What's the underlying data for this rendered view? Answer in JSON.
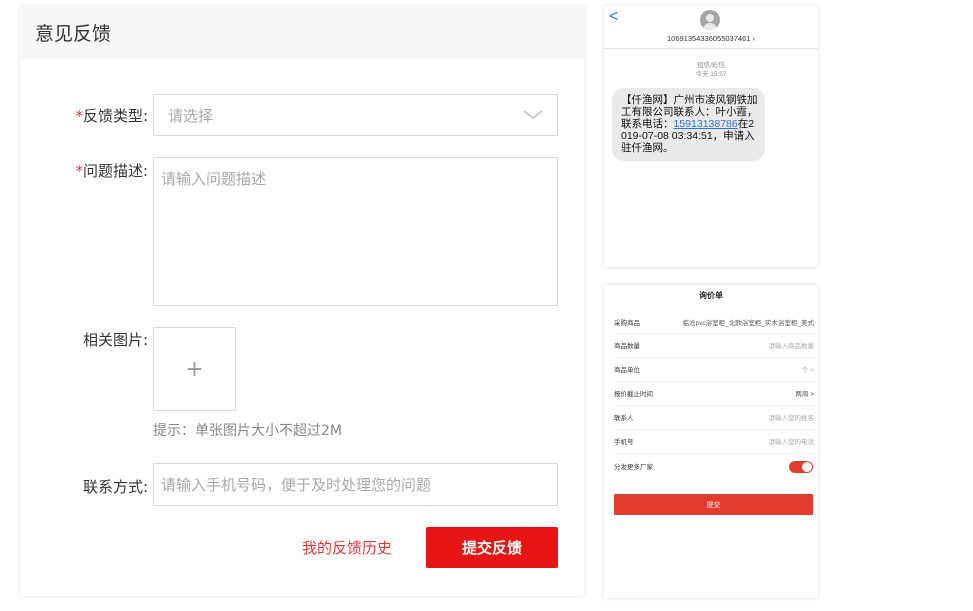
{
  "feedback": {
    "title": "意见反馈",
    "type_required": "*",
    "type_label": "反馈类型:",
    "type_placeholder": "请选择",
    "desc_required": "*",
    "desc_label": "问题描述:",
    "desc_placeholder": "请输入问题描述",
    "image_label": "相关图片:",
    "upload_symbol": "+",
    "image_hint": "提示：单张图片大小不超过2M",
    "contact_label": "联系方式:",
    "contact_placeholder": "请输入手机号码，便于及时处理您的问题",
    "history_link": "我的反馈历史",
    "submit_button": "提交反馈",
    "accent_color": "#e81414"
  },
  "sms": {
    "back_symbol": "<",
    "sender_number": "10691354336055037461 ›",
    "message_type": "短信/彩信",
    "time": "今天 15:57",
    "message_prefix": "【仟渔网】广州市凌风钢铁加工有限公司联系人：叶小霞，联系电话：",
    "phone_link": "15913138786",
    "message_suffix": "在2019-07-08 03:34:51，申请入驻仟渔网。"
  },
  "inquiry": {
    "title": "询价单",
    "rows": [
      {
        "label": "采购商品",
        "value": "临沧pvc浴室柜_北欧浴室柜_实木浴室柜_美式"
      },
      {
        "label": "商品数量",
        "value": "请输入商品数量"
      },
      {
        "label": "商品单位",
        "value": "个  >"
      },
      {
        "label": "报价截止时间",
        "value": "两周  >"
      },
      {
        "label": "联系人",
        "value": "请输入您的姓名"
      },
      {
        "label": "手机号",
        "value": "请输入您的电话"
      },
      {
        "label": "分发更多厂家",
        "value": ""
      }
    ],
    "distribute_enabled": true,
    "submit_button": "提交",
    "accent_color": "#e33b2e"
  }
}
